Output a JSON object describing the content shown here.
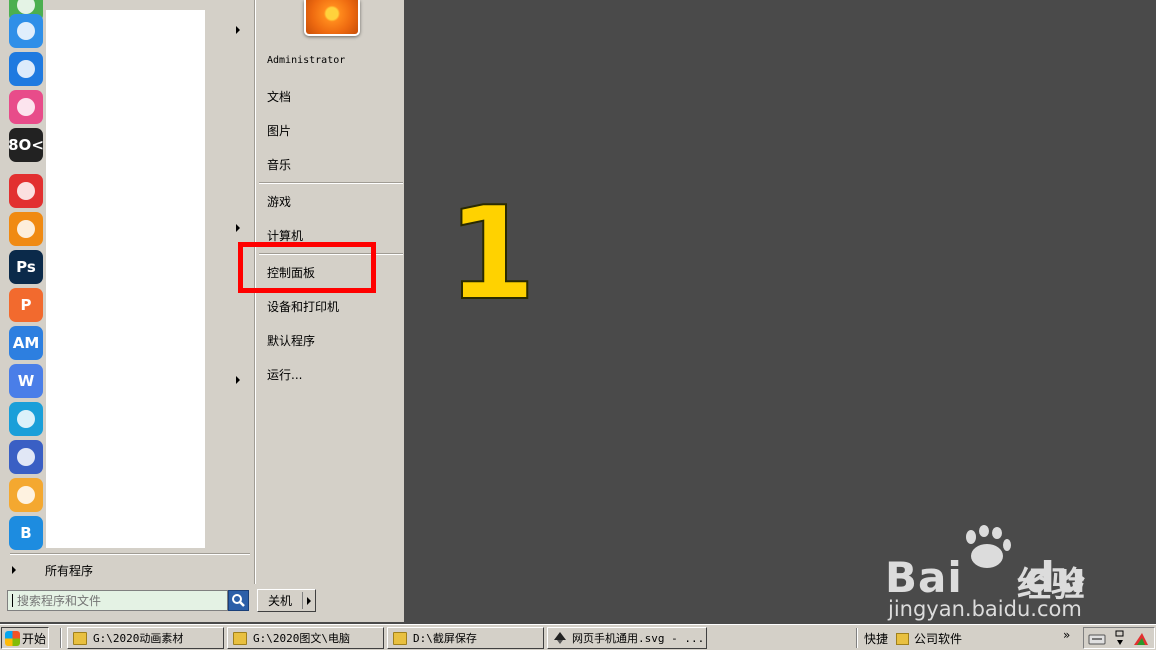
{
  "start_menu": {
    "pinned_icons": [
      {
        "icon": "wechat-icon",
        "color": "#4caf50"
      },
      {
        "icon": "cloud-icon",
        "color": "#2f8fe8"
      },
      {
        "icon": "shield-v-icon",
        "color": "#1f7ae0"
      },
      {
        "icon": "petals-icon",
        "color": "#e84c8a"
      },
      {
        "icon": "box-icon",
        "color": "#222222",
        "text": "8O<"
      },
      {
        "icon": "pie-icon",
        "color": "#e23030"
      },
      {
        "icon": "xnview-icon",
        "color": "#f08a12"
      },
      {
        "icon": "photoshop-icon",
        "color": "#0b2a4a",
        "text": "Ps"
      },
      {
        "icon": "wps-presentation-icon",
        "color": "#f26a2e",
        "text": "P"
      },
      {
        "icon": "axure-icon",
        "color": "#2d7fe0",
        "text": "AM"
      },
      {
        "icon": "wps-writer-icon",
        "color": "#4a7ee8",
        "text": "W"
      },
      {
        "icon": "edge-icon",
        "color": "#1a9fd9"
      },
      {
        "icon": "filmora-icon",
        "color": "#3a5fc4"
      },
      {
        "icon": "chat-bubble-icon",
        "color": "#f4a830"
      },
      {
        "icon": "app-b-icon",
        "color": "#1d8ce0",
        "text": "B"
      }
    ],
    "all_programs_label": "所有程序",
    "search": {
      "placeholder": "搜索程序和文件",
      "value": ""
    },
    "user_name": "Administrator",
    "items": {
      "documents": "文档",
      "pictures": "图片",
      "music": "音乐",
      "games": "游戏",
      "computer": "计算机",
      "control_panel": "控制面板",
      "devices_printers": "设备和打印机",
      "default_programs": "默认程序",
      "run": "运行..."
    },
    "shutdown_label": "关机"
  },
  "annotation": {
    "step_number": "1",
    "highlight_color": "#ff0000",
    "number_color": "#ffd200"
  },
  "watermark": {
    "brand_left": "Bai",
    "brand_right": "du",
    "product": "经验",
    "url": "jingyan.baidu.com"
  },
  "taskbar": {
    "start_label": "开始",
    "windows": [
      "G:\\2020动画素材",
      "G:\\2020图文\\电脑",
      "D:\\截屏保存",
      "网页手机通用.svg - ..."
    ],
    "quick_launch_label": "快捷",
    "company_software_label": "公司软件",
    "overflow_label": "»"
  }
}
